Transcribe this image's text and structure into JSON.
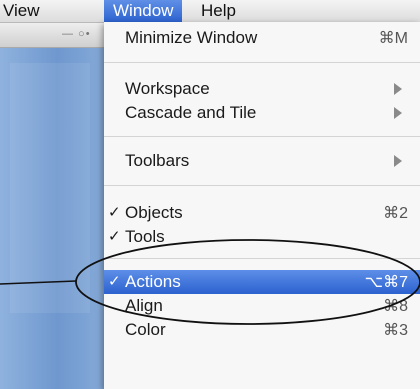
{
  "menubar": {
    "items": [
      {
        "label": "View"
      },
      {
        "label": "Window",
        "active": true
      },
      {
        "label": "Help"
      }
    ]
  },
  "toolbar": {
    "glyphs": "— ○•"
  },
  "window_menu": {
    "items": [
      {
        "label": "Minimize Window",
        "shortcut": "⌘M"
      },
      {
        "label": "Workspace",
        "submenu": true
      },
      {
        "label": "Cascade and Tile",
        "submenu": true
      },
      {
        "label": "Toolbars",
        "submenu": true
      },
      {
        "label": "Objects",
        "checked": true,
        "shortcut": "⌘2"
      },
      {
        "label": "Tools",
        "checked": true
      },
      {
        "label": "Actions",
        "checked": true,
        "shortcut": "⌥⌘7",
        "highlighted": true
      },
      {
        "label": "Align",
        "shortcut": "⌘8"
      },
      {
        "label": "Color",
        "shortcut": "⌘3"
      }
    ],
    "check_glyph": "✓"
  },
  "colors": {
    "highlight": "#2c62cf",
    "callout_stroke": "#111111"
  }
}
